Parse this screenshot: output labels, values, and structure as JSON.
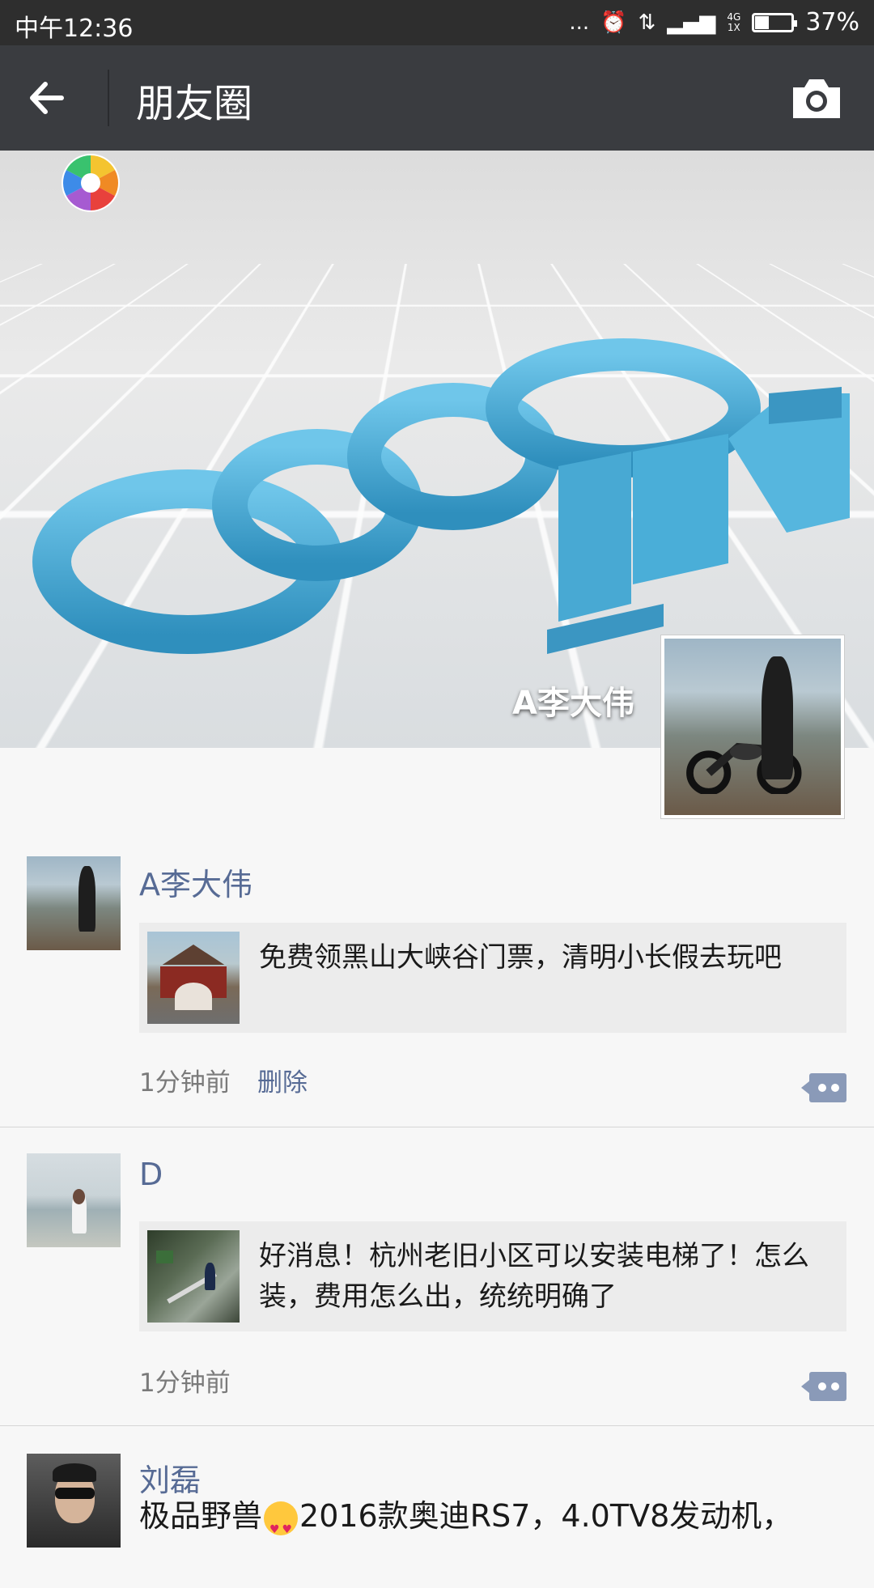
{
  "status_bar": {
    "time": "中午12:36",
    "signal_dots": "...",
    "network_top": "4G",
    "network_bottom": "1X",
    "battery": "37%",
    "battery_level": 0.37
  },
  "nav": {
    "title": "朋友圈"
  },
  "cover": {
    "owner_name": "A李大伟"
  },
  "posts": [
    {
      "name": "A李大伟",
      "link_text": "免费领黑山大峡谷门票，清明小长假去玩吧",
      "time": "1分钟前",
      "delete_label": "删除"
    },
    {
      "name": "D",
      "link_text": "好消息！杭州老旧小区可以安装电梯了！怎么装，费用怎么出，统统明确了",
      "time": "1分钟前"
    },
    {
      "name": "刘磊",
      "text_before_emoji": "极品野兽",
      "text_after_emoji": "2016款奥迪RS7，4.0TV8发动机，"
    }
  ],
  "colors": {
    "nav_bg": "#3a3c40",
    "status_bg": "#2e2e2e",
    "link_blue": "#576b95",
    "cover_logo_blue": "#4aaed8"
  }
}
